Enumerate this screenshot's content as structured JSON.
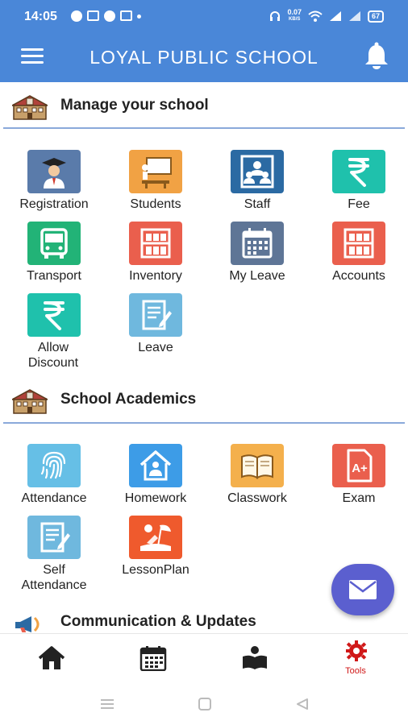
{
  "status_bar": {
    "time": "14:05",
    "network_speed": "0.07",
    "network_unit": "KB/S",
    "battery": "67"
  },
  "app_bar": {
    "title": "LOYAL PUBLIC SCHOOL",
    "menu_icon": "hamburger-icon",
    "notification_icon": "bell-icon"
  },
  "sections": {
    "manage": {
      "title": "Manage your school",
      "icon": "school-building-icon",
      "items": [
        {
          "label": "Registration",
          "icon": "graduate-icon",
          "color": "#5a7baa"
        },
        {
          "label": "Students",
          "icon": "classroom-board-icon",
          "color": "#f1a244"
        },
        {
          "label": "Staff",
          "icon": "staff-group-icon",
          "color": "#2b6aa3"
        },
        {
          "label": "Fee",
          "icon": "rupee-icon",
          "color": "#1fc1ac"
        },
        {
          "label": "Transport",
          "icon": "bus-icon",
          "color": "#22b377"
        },
        {
          "label": "Inventory",
          "icon": "shelf-icon",
          "color": "#ea5f4d"
        },
        {
          "label": "My Leave",
          "icon": "calendar-icon",
          "color": "#5e7596"
        },
        {
          "label": "Accounts",
          "icon": "shelf-icon",
          "color": "#ea5f4d"
        },
        {
          "label": "Allow Discount",
          "icon": "rupee-icon",
          "color": "#1fc1ac"
        },
        {
          "label": "Leave",
          "icon": "document-edit-icon",
          "color": "#6fb8de"
        }
      ]
    },
    "academics": {
      "title": "School Academics",
      "icon": "school-building-icon",
      "items": [
        {
          "label": "Attendance",
          "icon": "fingerprint-icon",
          "color": "#66bfe6"
        },
        {
          "label": "Homework",
          "icon": "home-study-icon",
          "color": "#3d9ce7"
        },
        {
          "label": "Classwork",
          "icon": "open-book-icon",
          "color": "#f4b04c"
        },
        {
          "label": "Exam",
          "icon": "exam-grade-icon",
          "color": "#ea5f4d"
        },
        {
          "label": "Self Attendance",
          "icon": "document-edit-icon",
          "color": "#6fb8de"
        },
        {
          "label": "LessonPlan",
          "icon": "beach-icon",
          "color": "#ef5a2d"
        }
      ]
    },
    "communication": {
      "title": "Communication & Updates",
      "icon": "megaphone-icon"
    }
  },
  "fab": {
    "icon": "mail-icon"
  },
  "bottom_nav": [
    {
      "label": "",
      "icon": "home-icon"
    },
    {
      "label": "",
      "icon": "calendar-icon"
    },
    {
      "label": "",
      "icon": "book-reader-icon"
    },
    {
      "label": "Tools",
      "icon": "gear-tools-icon",
      "active": true
    }
  ],
  "colors": {
    "primary": "#4a87d8",
    "fab": "#5b5fcf",
    "active_nav": "#d01818",
    "divider": "#8aa9da"
  }
}
